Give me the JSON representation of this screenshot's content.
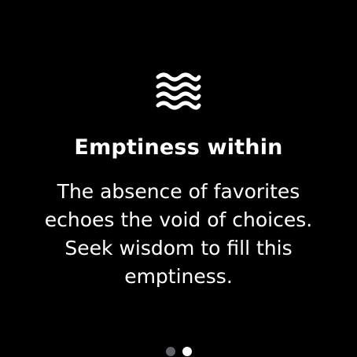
{
  "screen": {
    "icon": "waves-icon",
    "title": "Emptiness within",
    "message": "The absence of favorites echoes the void of choices. Seek wisdom to fill this emptiness."
  },
  "pager": {
    "pages": [
      {
        "active": false
      },
      {
        "active": true
      }
    ]
  },
  "colors": {
    "background": "#000000",
    "text": "#ffffff",
    "dot_inactive": "#5f6368",
    "dot_active": "#ffffff"
  }
}
